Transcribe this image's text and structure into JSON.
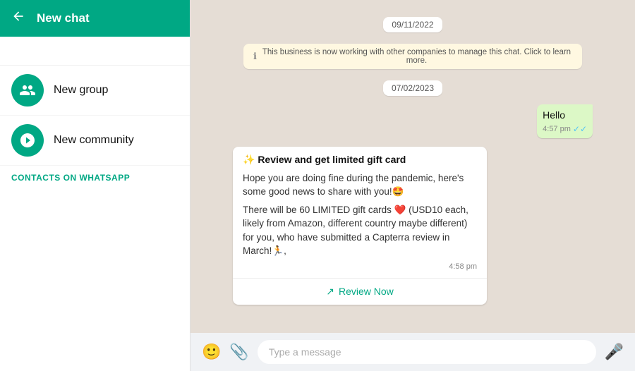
{
  "header": {
    "title": "New chat",
    "back_label": "←"
  },
  "search": {
    "placeholder": ""
  },
  "menu": {
    "new_group": {
      "label": "New group",
      "icon": "group-icon"
    },
    "new_community": {
      "label": "New community",
      "icon": "community-icon"
    },
    "contacts_header": "CONTACTS ON WHATSAPP"
  },
  "chat": {
    "date1": "09/11/2022",
    "info_banner": "This business is now working with other companies to manage this chat. Click to learn more.",
    "date2": "07/02/2023",
    "hello_message": {
      "text": "Hello",
      "time": "4:57 pm",
      "status": "✓✓"
    },
    "card": {
      "title": "✨ Review and get limited gift card",
      "text1": "Hope you are doing fine during the pandemic, here's some good news to share with you!🤩",
      "text2": "There will be 60 LIMITED gift cards ❤️ (USD10 each, likely from Amazon, different country maybe different) for you, who have submitted a Capterra review in March!🏃,",
      "time": "4:58 pm",
      "link_label": "Review Now",
      "link_icon": "external-link-icon"
    }
  },
  "bottom_bar": {
    "emoji_icon": "emoji-icon",
    "attach_icon": "attach-icon",
    "placeholder": "Type a message",
    "mic_icon": "mic-icon"
  }
}
